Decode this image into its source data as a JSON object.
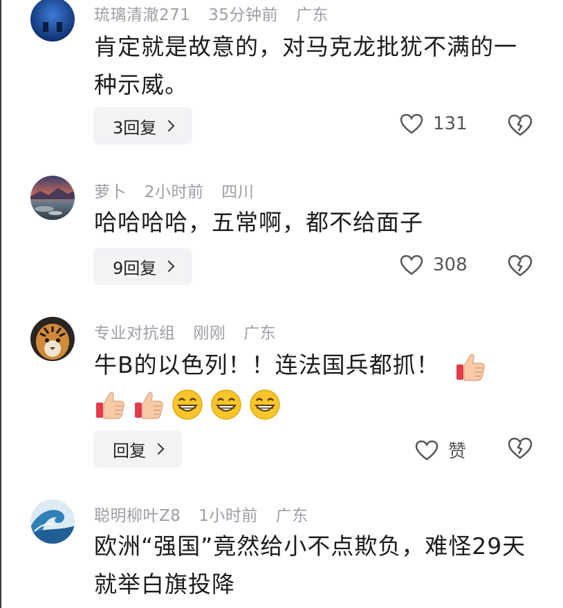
{
  "comments": [
    {
      "username": "琉璃清澈271",
      "time": "35分钟前",
      "location": "广东",
      "text": "肯定就是故意的，对马克龙批犹不满的一种示威。",
      "reply_label": "3回复",
      "like_count": "131",
      "avatar_icon": "avatar-blue-icon"
    },
    {
      "username": "萝卜",
      "time": "2小时前",
      "location": "四川",
      "text": "哈哈哈哈，五常啊，都不给面子",
      "reply_label": "9回复",
      "like_count": "308",
      "avatar_icon": "avatar-landscape-icon"
    },
    {
      "username": "专业对抗组",
      "time": "刚刚",
      "location": "广东",
      "text": "牛B的以色列！！连法国兵都抓！",
      "reply_label": "回复",
      "like_count": "赞",
      "avatar_icon": "avatar-tiger-icon",
      "emojis": [
        "thumbs-up-emoji",
        "thumbs-up-emoji",
        "thumbs-up-emoji",
        "grin-emoji",
        "grin-emoji",
        "grin-emoji"
      ]
    },
    {
      "username": "聪明柳叶Z8",
      "time": "1小时前",
      "location": "广东",
      "text": "欧洲“强国”竟然给小不点欺负，难怪29天就举白旗投降",
      "avatar_icon": "avatar-wave-icon"
    }
  ],
  "colors": {
    "meta_text": "#9b9ea5",
    "reply_bg": "#f2f3f5",
    "body_text": "#1c1c1c"
  }
}
